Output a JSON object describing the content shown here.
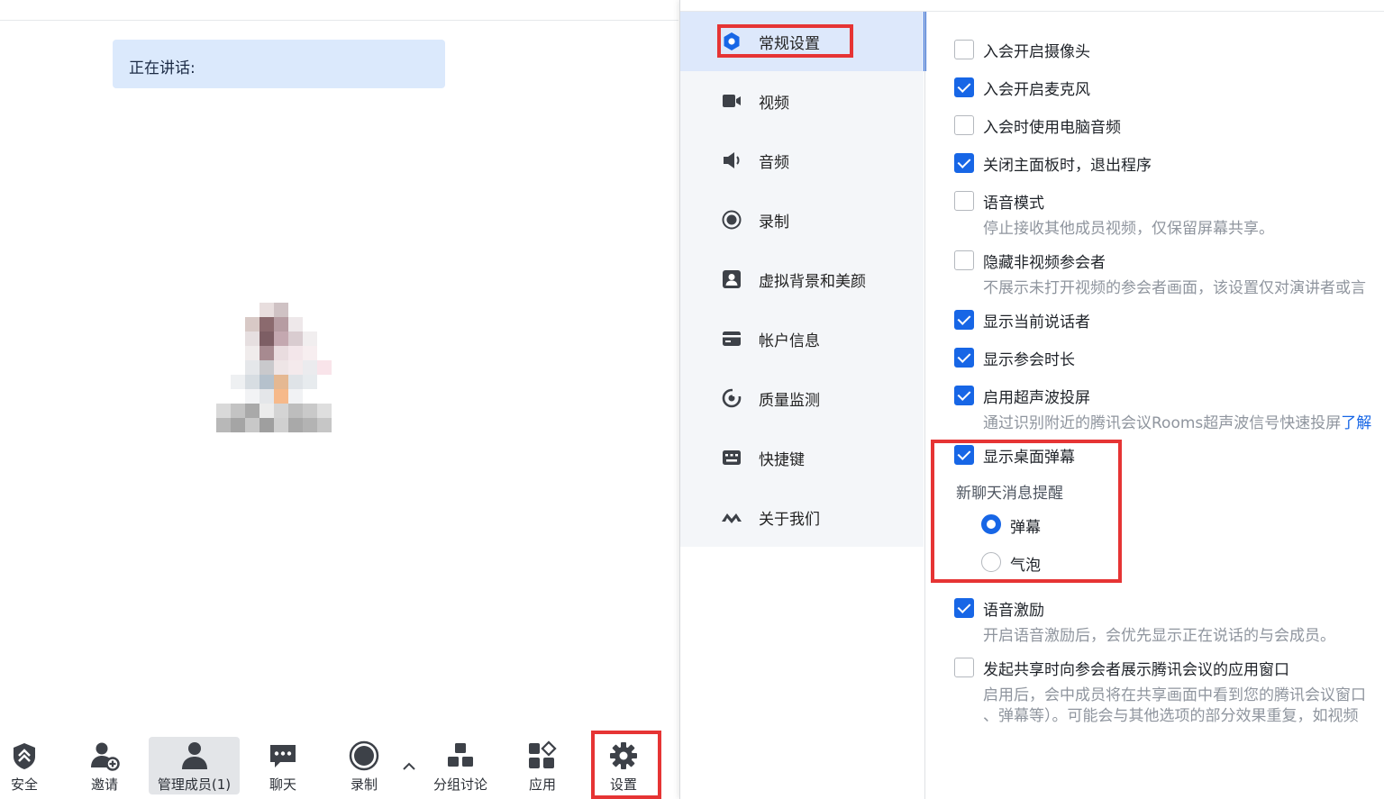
{
  "meeting": {
    "speaking_label": "正在讲话:"
  },
  "toolbar": {
    "items": [
      {
        "id": "security",
        "label": "安全",
        "icon": "shield-icon"
      },
      {
        "id": "invite",
        "label": "邀请",
        "icon": "add-person-icon"
      },
      {
        "id": "members",
        "label": "管理成员(1)",
        "icon": "members-icon"
      },
      {
        "id": "chat",
        "label": "聊天",
        "icon": "chat-icon"
      },
      {
        "id": "record",
        "label": "录制",
        "icon": "record-icon"
      },
      {
        "id": "breakout",
        "label": "分组讨论",
        "icon": "breakout-icon"
      },
      {
        "id": "apps",
        "label": "应用",
        "icon": "apps-icon"
      },
      {
        "id": "settings",
        "label": "设置",
        "icon": "gear-icon"
      }
    ],
    "more_icon": "chevron-up-icon"
  },
  "settings_nav": {
    "items": [
      {
        "label": "常规设置",
        "icon": "general-settings-icon",
        "selected": true
      },
      {
        "label": "视频",
        "icon": "video-camera-icon"
      },
      {
        "label": "音频",
        "icon": "speaker-icon"
      },
      {
        "label": "录制",
        "icon": "record-icon"
      },
      {
        "label": "虚拟背景和美颜",
        "icon": "portrait-icon"
      },
      {
        "label": "帐户信息",
        "icon": "card-icon"
      },
      {
        "label": "质量监测",
        "icon": "monitor-icon"
      },
      {
        "label": "快捷键",
        "icon": "keyboard-icon"
      },
      {
        "label": "关于我们",
        "icon": "logo-icon"
      }
    ]
  },
  "general": {
    "options": [
      {
        "label": "入会开启摄像头",
        "checked": false
      },
      {
        "label": "入会开启麦克风",
        "checked": true
      },
      {
        "label": "入会时使用电脑音频",
        "checked": false
      },
      {
        "label": "关闭主面板时，退出程序",
        "checked": true
      },
      {
        "label": "语音模式",
        "checked": false,
        "desc": "停止接收其他成员视频，仅保留屏幕共享。"
      },
      {
        "label": "隐藏非视频参会者",
        "checked": false,
        "desc": "不展示未打开视频的参会者画面，该设置仅对演讲者或言"
      },
      {
        "label": "显示当前说话者",
        "checked": true
      },
      {
        "label": "显示参会时长",
        "checked": true
      },
      {
        "label": "启用超声波投屏",
        "checked": true,
        "desc": "通过识别附近的腾讯会议Rooms超声波信号快速投屏",
        "link": "了解"
      },
      {
        "label": "显示桌面弹幕",
        "checked": true
      },
      {
        "label": "语音激励",
        "checked": true,
        "desc": "开启语音激励后，会优先显示正在说话的与会成员。"
      },
      {
        "label": "发起共享时向参会者展示腾讯会议的应用窗口",
        "checked": false,
        "desc": "启用后，会中成员将在共享画面中看到您的腾讯会议窗口",
        "desc2": "、弹幕等）。可能会与其他选项的部分效果重复，如视频"
      }
    ],
    "chat_notify": {
      "title": "新聊天消息提醒",
      "radios": [
        {
          "label": "弹幕",
          "selected": true
        },
        {
          "label": "气泡",
          "selected": false
        }
      ]
    }
  },
  "colors": {
    "accent": "#1766e6",
    "highlight": "#e63434",
    "nav_selected": "#dde8fb"
  }
}
